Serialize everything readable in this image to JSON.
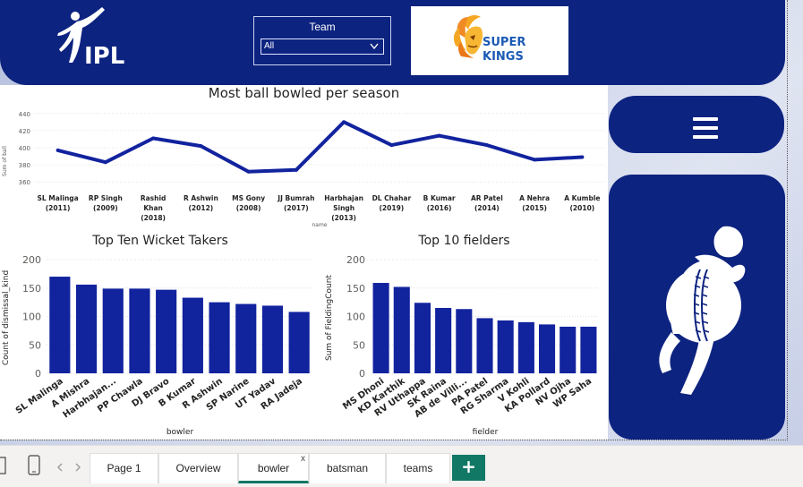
{
  "header": {
    "logo_text": "IPL",
    "team_filter": {
      "title": "Team",
      "selected": "All"
    },
    "team_logo_text": [
      "SUPER",
      "KINGS"
    ]
  },
  "charts": {
    "line": {
      "title": "Most ball bowled per season",
      "xlabel": "name",
      "ylabel": "Sum of ball",
      "categories": [
        [
          "SL Malinga",
          "(2011)"
        ],
        [
          "RP Singh",
          "(2009)"
        ],
        [
          "Rashid",
          "Khan",
          "(2018)"
        ],
        [
          "R Ashwin",
          "(2012)"
        ],
        [
          "MS Gony",
          "(2008)"
        ],
        [
          "JJ Bumrah",
          "(2017)"
        ],
        [
          "Harbhajan",
          "Singh",
          "(2013)"
        ],
        [
          "DL Chahar",
          "(2019)"
        ],
        [
          "B Kumar",
          "(2016)"
        ],
        [
          "AR Patel",
          "(2014)"
        ],
        [
          "A Nehra",
          "(2015)"
        ],
        [
          "A Kumble",
          "(2010)"
        ]
      ],
      "yticks": [
        "440",
        "420",
        "400",
        "380",
        "360"
      ]
    },
    "wicket": {
      "title": "Top Ten Wicket Takers",
      "xlabel": "bowler",
      "ylabel": "Count of dismissal_kind",
      "yticks": [
        "200",
        "150",
        "100",
        "50",
        "0"
      ]
    },
    "fielders": {
      "title": "Top 10 fielders",
      "xlabel": "fielder",
      "ylabel": "Sum of FieldingCount",
      "yticks": [
        "200",
        "150",
        "100",
        "50",
        "0"
      ]
    }
  },
  "chart_data": [
    {
      "type": "line",
      "title": "Most ball bowled per season",
      "xlabel": "name",
      "ylabel": "Sum of ball",
      "categories": [
        "SL Malinga (2011)",
        "RP Singh (2009)",
        "Rashid Khan (2018)",
        "R Ashwin (2012)",
        "MS Gony (2008)",
        "JJ Bumrah (2017)",
        "Harbhajan Singh (2013)",
        "DL Chahar (2019)",
        "B Kumar (2016)",
        "AR Patel (2014)",
        "A Nehra (2015)",
        "A Kumble (2010)"
      ],
      "values": [
        397,
        383,
        411,
        402,
        372,
        374,
        430,
        403,
        414,
        403,
        386,
        389
      ],
      "ylim": [
        355,
        445
      ],
      "color": "#12239e"
    },
    {
      "type": "bar",
      "title": "Top Ten Wicket Takers",
      "xlabel": "bowler",
      "ylabel": "Count of dismissal_kind",
      "categories": [
        "SL Malinga",
        "A Mishra",
        "Harbhajan...",
        "PP Chawla",
        "DJ Bravo",
        "B Kumar",
        "R Ashwin",
        "SP Narine",
        "UT Yadav",
        "RA Jadeja"
      ],
      "values": [
        170,
        156,
        149,
        149,
        147,
        133,
        125,
        122,
        119,
        108
      ],
      "ylim": [
        0,
        200
      ],
      "color": "#12239e"
    },
    {
      "type": "bar",
      "title": "Top 10 fielders",
      "xlabel": "fielder",
      "ylabel": "Sum of FieldingCount",
      "categories": [
        "MS Dhoni",
        "KD Karthik",
        "RV Uthappa",
        "SK Raina",
        "AB de Villi...",
        "PA Patel",
        "RG Sharma",
        "V Kohli",
        "KA Pollard",
        "NV Ojha",
        "WP Saha"
      ],
      "values": [
        159,
        152,
        124,
        115,
        113,
        97,
        93,
        90,
        86,
        82,
        82
      ],
      "ylim": [
        0,
        200
      ],
      "color": "#12239e"
    }
  ],
  "tabs": [
    {
      "label": "Page 1"
    },
    {
      "label": "Overview"
    },
    {
      "label": "bowler",
      "active": true
    },
    {
      "label": "batsman"
    },
    {
      "label": "teams"
    }
  ],
  "tabbar": {
    "add_label": "+",
    "close_label": "x"
  },
  "colors": {
    "navy": "#0d2380",
    "bar": "#12239e",
    "accent": "#117865",
    "csk_yellow": "#f5a623"
  },
  "icons": {
    "menu": "hamburger-menu-icon",
    "cricket": "cricket-player-icon",
    "mobile": "mobile-layout-icon",
    "nav": "tab-scroll-arrows-icon"
  }
}
